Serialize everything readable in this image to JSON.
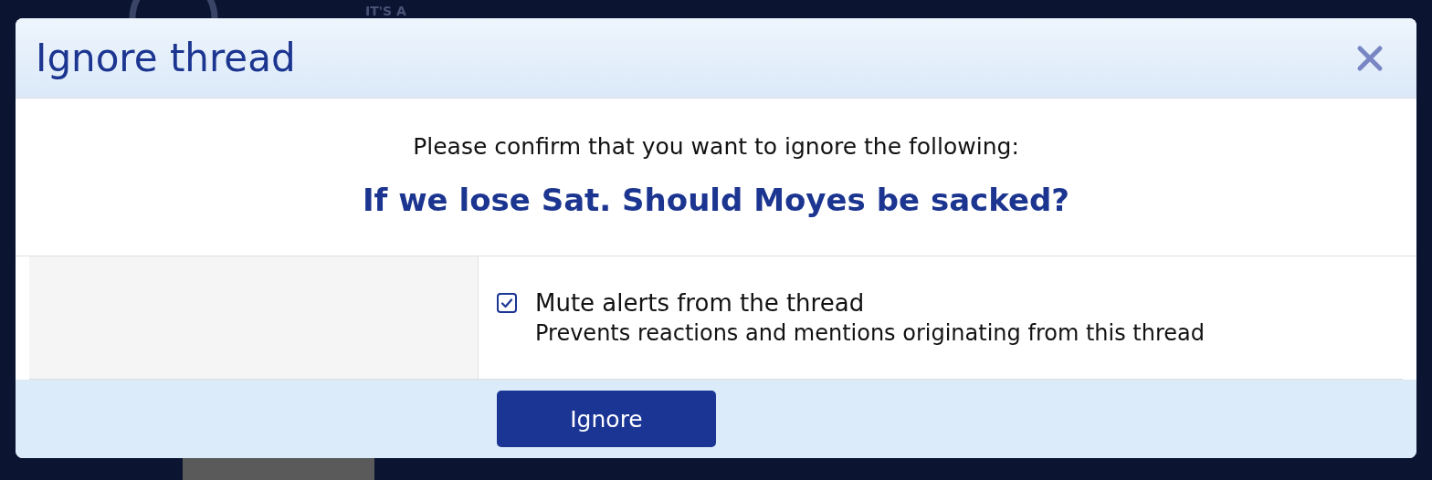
{
  "background": {
    "banner_text": "IT'S A"
  },
  "dialog": {
    "title": "Ignore thread",
    "message": "Please confirm that you want to ignore the following:",
    "thread_title": "If we lose Sat. Should Moyes be sacked?",
    "options": [
      {
        "label": "Mute alerts from the thread",
        "description": "Prevents reactions and mentions originating from this thread",
        "checked": true
      }
    ],
    "buttons": [
      "Ignore"
    ]
  }
}
